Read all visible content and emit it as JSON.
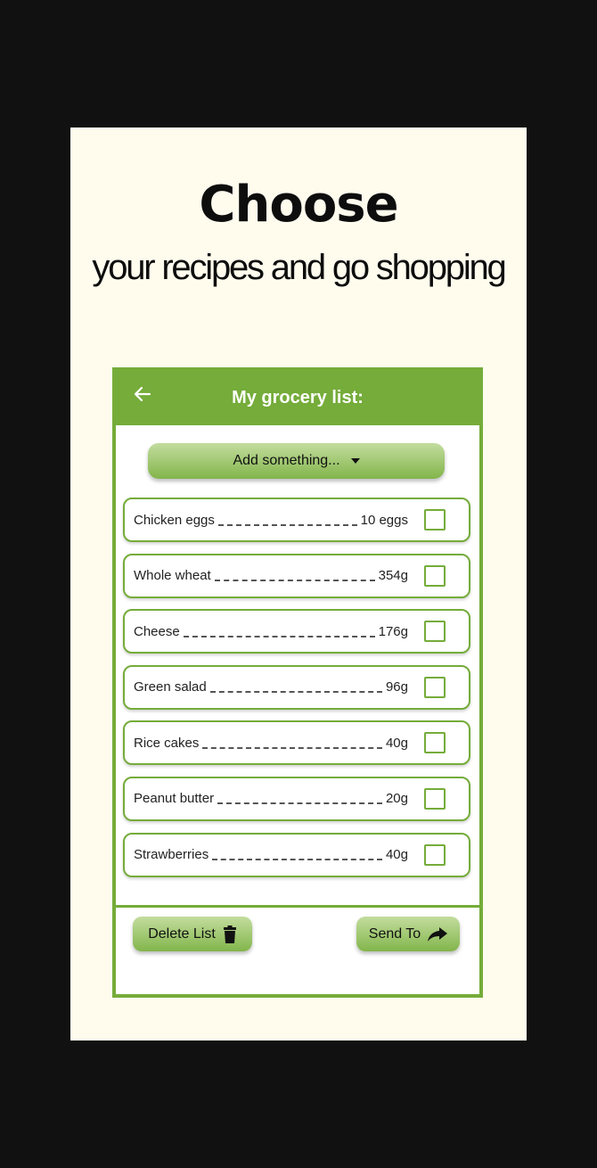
{
  "headline": "Choose",
  "subline": "your recipes and go shopping",
  "app": {
    "title": "My grocery list:",
    "add_label": "Add something...",
    "delete_label": "Delete List",
    "send_label": "Send To",
    "accent": "#75ac3a",
    "background": "#fffcee"
  },
  "items": [
    {
      "name": "Chicken eggs",
      "qty": "10 eggs",
      "checked": false
    },
    {
      "name": "Whole wheat",
      "qty": "354g",
      "checked": false
    },
    {
      "name": "Cheese",
      "qty": "176g",
      "checked": false
    },
    {
      "name": "Green salad",
      "qty": "96g",
      "checked": false
    },
    {
      "name": "Rice cakes",
      "qty": "40g",
      "checked": false
    },
    {
      "name": "Peanut butter",
      "qty": "20g",
      "checked": false
    },
    {
      "name": "Strawberries",
      "qty": "40g",
      "checked": false
    }
  ]
}
